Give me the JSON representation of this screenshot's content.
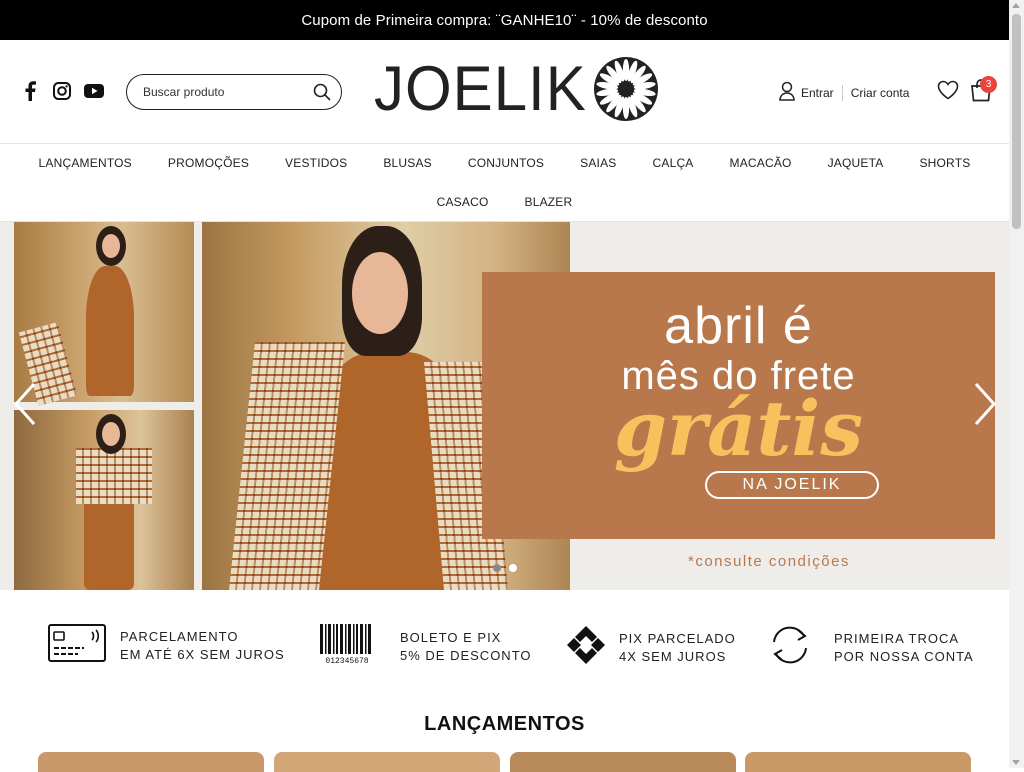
{
  "topbar": {
    "text": "Cupom de Primeira compra: ¨GANHE10¨ - 10% de desconto"
  },
  "header": {
    "search_placeholder": "Buscar produto",
    "logo_text": "JOELIK",
    "login_label": "Entrar",
    "signup_label": "Criar conta",
    "cart_count": "3",
    "icons": [
      "facebook-icon",
      "instagram-icon",
      "youtube-icon",
      "search-icon",
      "user-icon",
      "heart-icon",
      "bag-icon"
    ]
  },
  "nav": {
    "row1": [
      "LANÇAMENTOS",
      "PROMOÇÕES",
      "VESTIDOS",
      "BLUSAS",
      "CONJUNTOS",
      "SAIAS",
      "CALÇA",
      "MACACÃO",
      "JAQUETA",
      "SHORTS"
    ],
    "row2": [
      "CASACO",
      "BLAZER"
    ]
  },
  "hero": {
    "line1": "abril é",
    "line2": "mês do frete",
    "line3": "grátis",
    "pill": "NA JOELIK",
    "note": "*consulte condições",
    "slide_count": 2,
    "active_slide": 2,
    "accent_color": "#b8784c",
    "highlight_color": "#f7c25e"
  },
  "benefits": [
    {
      "line1": "PARCELAMENTO",
      "line2": "EM ATÉ 6X SEM JUROS",
      "icon": "credit-card-icon"
    },
    {
      "line1": "BOLETO E PIX",
      "line2": "5% DE DESCONTO",
      "icon": "barcode-icon",
      "barcode_digits": "012345678"
    },
    {
      "line1": "PIX PARCELADO",
      "line2": "4X SEM JUROS",
      "icon": "pix-icon"
    },
    {
      "line1": "PRIMEIRA TROCA",
      "line2": "POR NOSSA CONTA",
      "icon": "exchange-icon"
    }
  ],
  "launches": {
    "title": "LANÇAMENTOS"
  }
}
